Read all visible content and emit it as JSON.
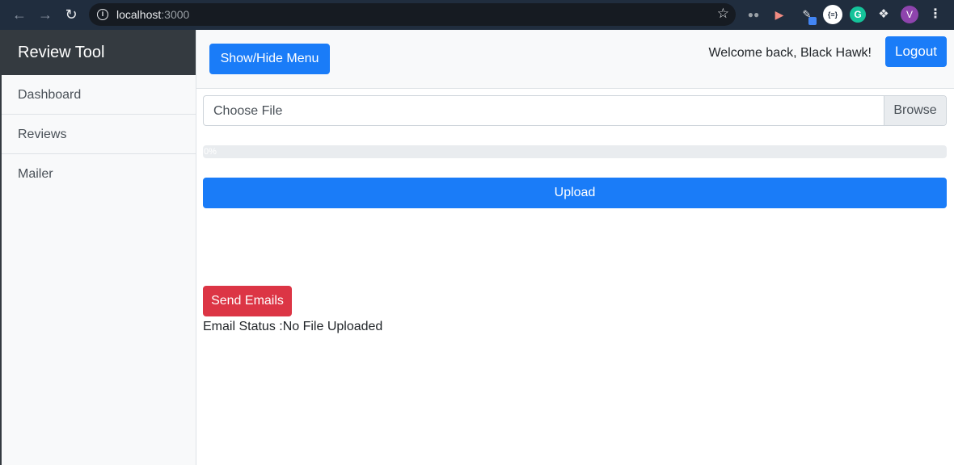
{
  "browser": {
    "url_host": "localhost",
    "url_port": ":3000",
    "profile_initial": "V"
  },
  "sidebar": {
    "title": "Review Tool",
    "items": [
      {
        "label": "Dashboard"
      },
      {
        "label": "Reviews"
      },
      {
        "label": "Mailer"
      }
    ]
  },
  "topbar": {
    "toggle_label": "Show/Hide Menu",
    "welcome": "Welcome back, Black Hawk!",
    "logout_label": "Logout"
  },
  "upload": {
    "file_placeholder": "Choose File",
    "browse_label": "Browse",
    "progress_percent": 0,
    "progress_text": "0%",
    "upload_label": "Upload"
  },
  "mailer": {
    "send_label": "Send Emails",
    "status_prefix": "Email Status :",
    "status_value": "No File Uploaded"
  },
  "colors": {
    "primary": "#1a7cf8",
    "danger": "#dc3545",
    "sidebar_header": "#343a40",
    "chrome": "#202d3e"
  }
}
